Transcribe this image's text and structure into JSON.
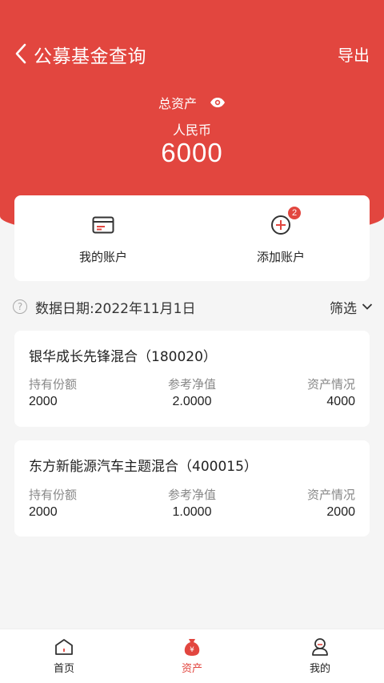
{
  "header": {
    "title": "公募基金查询",
    "export_label": "导出"
  },
  "summary": {
    "total_assets_label": "总资产",
    "currency": "人民币",
    "total_value": "6000"
  },
  "account_actions": [
    {
      "label": "我的账户",
      "icon": "card-icon"
    },
    {
      "label": "添加账户",
      "icon": "add-circle-icon",
      "badge": "2"
    }
  ],
  "data_date": "数据日期:2022年11月1日",
  "filter_label": "筛选",
  "columns": {
    "holding": "持有份额",
    "nav": "参考净值",
    "assets": "资产情况"
  },
  "funds": [
    {
      "name": "银华成长先锋混合（180020）",
      "holding": "2000",
      "nav": "2.0000",
      "assets": "4000"
    },
    {
      "name": "东方新能源汽车主题混合（400015）",
      "holding": "2000",
      "nav": "1.0000",
      "assets": "2000"
    }
  ],
  "tabbar": {
    "items": [
      {
        "label": "首页",
        "icon": "home-icon"
      },
      {
        "label": "资产",
        "icon": "money-bag-icon"
      },
      {
        "label": "我的",
        "icon": "profile-icon"
      }
    ]
  },
  "colors": {
    "brand_red": "#e2463f",
    "background": "#f5f5f5"
  }
}
